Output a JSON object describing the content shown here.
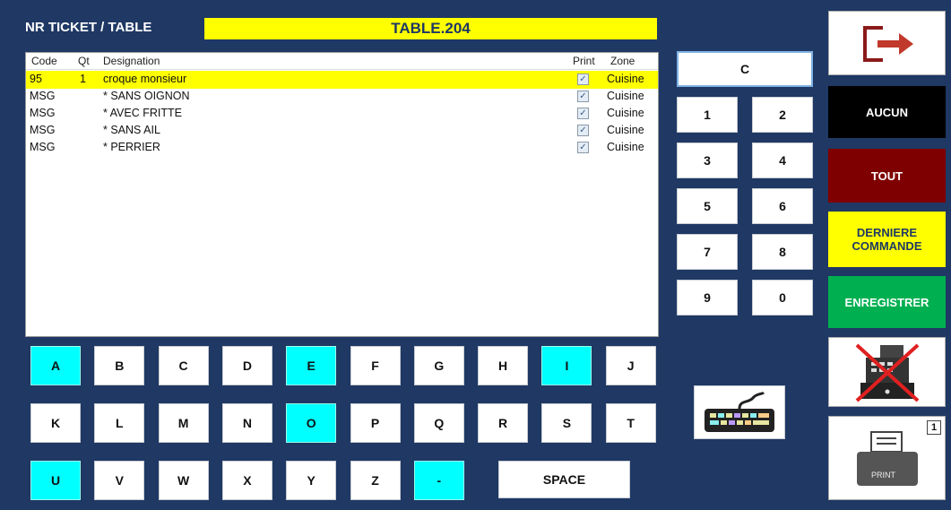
{
  "header": {
    "label": "NR TICKET / TABLE",
    "table_value": "TABLE.204"
  },
  "grid": {
    "columns": {
      "code": "Code",
      "qt": "Qt",
      "designation": "Designation",
      "print": "Print",
      "zone": "Zone"
    },
    "rows": [
      {
        "code": "95",
        "qt": "1",
        "designation": "croque monsieur",
        "print": true,
        "zone": "Cuisine",
        "selected": true
      },
      {
        "code": "MSG",
        "qt": "",
        "designation": "* SANS OIGNON",
        "print": true,
        "zone": "Cuisine",
        "selected": false
      },
      {
        "code": "MSG",
        "qt": "",
        "designation": "* AVEC FRITTE",
        "print": true,
        "zone": "Cuisine",
        "selected": false
      },
      {
        "code": "MSG",
        "qt": "",
        "designation": "* SANS AIL",
        "print": true,
        "zone": "Cuisine",
        "selected": false
      },
      {
        "code": "MSG",
        "qt": "",
        "designation": "* PERRIER",
        "print": true,
        "zone": "Cuisine",
        "selected": false
      }
    ]
  },
  "keyboard": {
    "rows": [
      [
        "A",
        "B",
        "C",
        "D",
        "E",
        "F",
        "G",
        "H",
        "I",
        "J"
      ],
      [
        "K",
        "L",
        "M",
        "N",
        "O",
        "P",
        "Q",
        "R",
        "S",
        "T"
      ],
      [
        "U",
        "V",
        "W",
        "X",
        "Y",
        "Z",
        "-"
      ]
    ],
    "highlighted": [
      "A",
      "E",
      "I",
      "O",
      "U",
      "-"
    ],
    "space_label": "SPACE"
  },
  "numpad": {
    "clear_label": "C",
    "keys": [
      "1",
      "2",
      "3",
      "4",
      "5",
      "6",
      "7",
      "8",
      "9",
      "0"
    ]
  },
  "actions": {
    "exit_icon": "exit-door-icon",
    "aucun": "AUCUN",
    "tout": "TOUT",
    "derniere_line1": "DERNIERE",
    "derniere_line2": "COMMANDE",
    "enregistrer": "ENREGISTRER",
    "print_label": "PRINT",
    "print_count": "1"
  },
  "colors": {
    "background": "#1f3864",
    "yellow": "#ffff00",
    "cyan": "#00ffff",
    "aucun_bg": "#000000",
    "tout_bg": "#7f0000",
    "enregistrer_bg": "#00b050"
  }
}
